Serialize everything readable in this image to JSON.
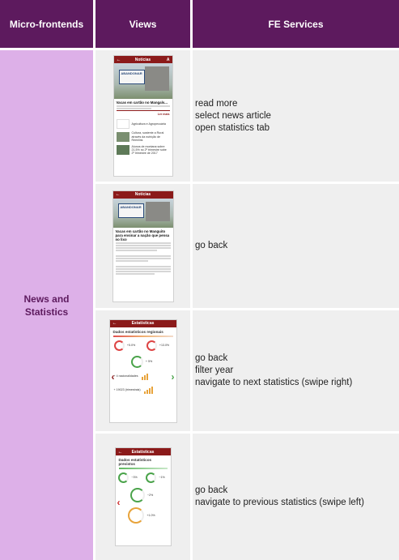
{
  "headers": {
    "micro_frontends": "Micro-frontends",
    "views": "Views",
    "fe_services": "FE Services"
  },
  "micro_frontend": {
    "line1": "News and",
    "line2": "Statistics"
  },
  "rows": [
    {
      "screen": {
        "title": "Notícias",
        "sign_text": "ABANDONAR",
        "headline": "Vacas em cartão no Mangals...",
        "related1": "Agricultura e Agropecuária",
        "related2": "Cultura, sustente a Rural através da nutrição de Reenlins",
        "related3": "Alunos de montana sobre 21,5% no 2º trimestre sobe 2º trimestre de 2017",
        "read_more": "Ler mais"
      },
      "services": [
        "read more",
        "select news article",
        "open statistics tab"
      ]
    },
    {
      "screen": {
        "title": "Notícias",
        "sign_text": "ABANDONAR",
        "headline": "Vacas em cartão no Manguito para ensinar a nação que pensa no lixo"
      },
      "services": [
        "go back"
      ]
    },
    {
      "screen": {
        "title": "Estatísticas",
        "heading": "Dados estatísticos regionais",
        "value1": "+5.0%",
        "value2": "+13.0%",
        "value3": "+ 5%",
        "value4": "+ 4 nacionalidades",
        "value5": "+ 19023 (trimestrais)"
      },
      "services": [
        "go back",
        "filter year",
        "navigate to next statistics (swipe right)"
      ]
    },
    {
      "screen": {
        "title": "Estatísticas",
        "heading": "Dados estatísticos previstos",
        "value1": "~3%",
        "value2": "~1%",
        "value3": "~2%",
        "value4": "+1.0%"
      },
      "services": [
        "go back",
        "navigate to previous statistics (swipe left)"
      ]
    }
  ],
  "colors": {
    "header_bg": "#5d1a5e",
    "side_bg": "#ddb0e8",
    "cell_bg": "#efefef",
    "app_bar": "#8b1a1a"
  }
}
